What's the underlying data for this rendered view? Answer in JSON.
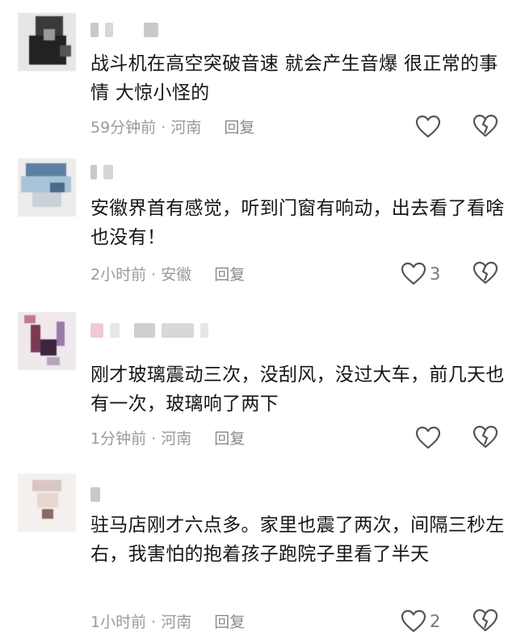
{
  "comments": [
    {
      "text": "战斗机在高空突破音速 就会产生音爆  很正常的事情  大惊小怪的",
      "time": "59分钟前",
      "location": "河南",
      "reply_label": "回复",
      "like_count": ""
    },
    {
      "text": "安徽界首有感觉，听到门窗有响动，出去看了看啥也没有！",
      "time": "2小时前",
      "location": "安徽",
      "reply_label": "回复",
      "like_count": "3"
    },
    {
      "text": "刚才玻璃震动三次，没刮风，没过大车，前几天也有一次，玻璃响了两下",
      "time": "1分钟前",
      "location": "河南",
      "reply_label": "回复",
      "like_count": ""
    },
    {
      "text": "驻马店刚才六点多。家里也震了两次，间隔三秒左右，我害怕的抱着孩子跑院子里看了半天",
      "time": "1小时前",
      "location": "河南",
      "reply_label": "回复",
      "like_count": "2"
    }
  ],
  "separator": " · ",
  "icons": {
    "like": "heart-outline-icon",
    "dislike": "broken-heart-icon"
  },
  "colors": {
    "text": "#161616",
    "meta": "#9a9a9a",
    "icon": "#555555"
  }
}
